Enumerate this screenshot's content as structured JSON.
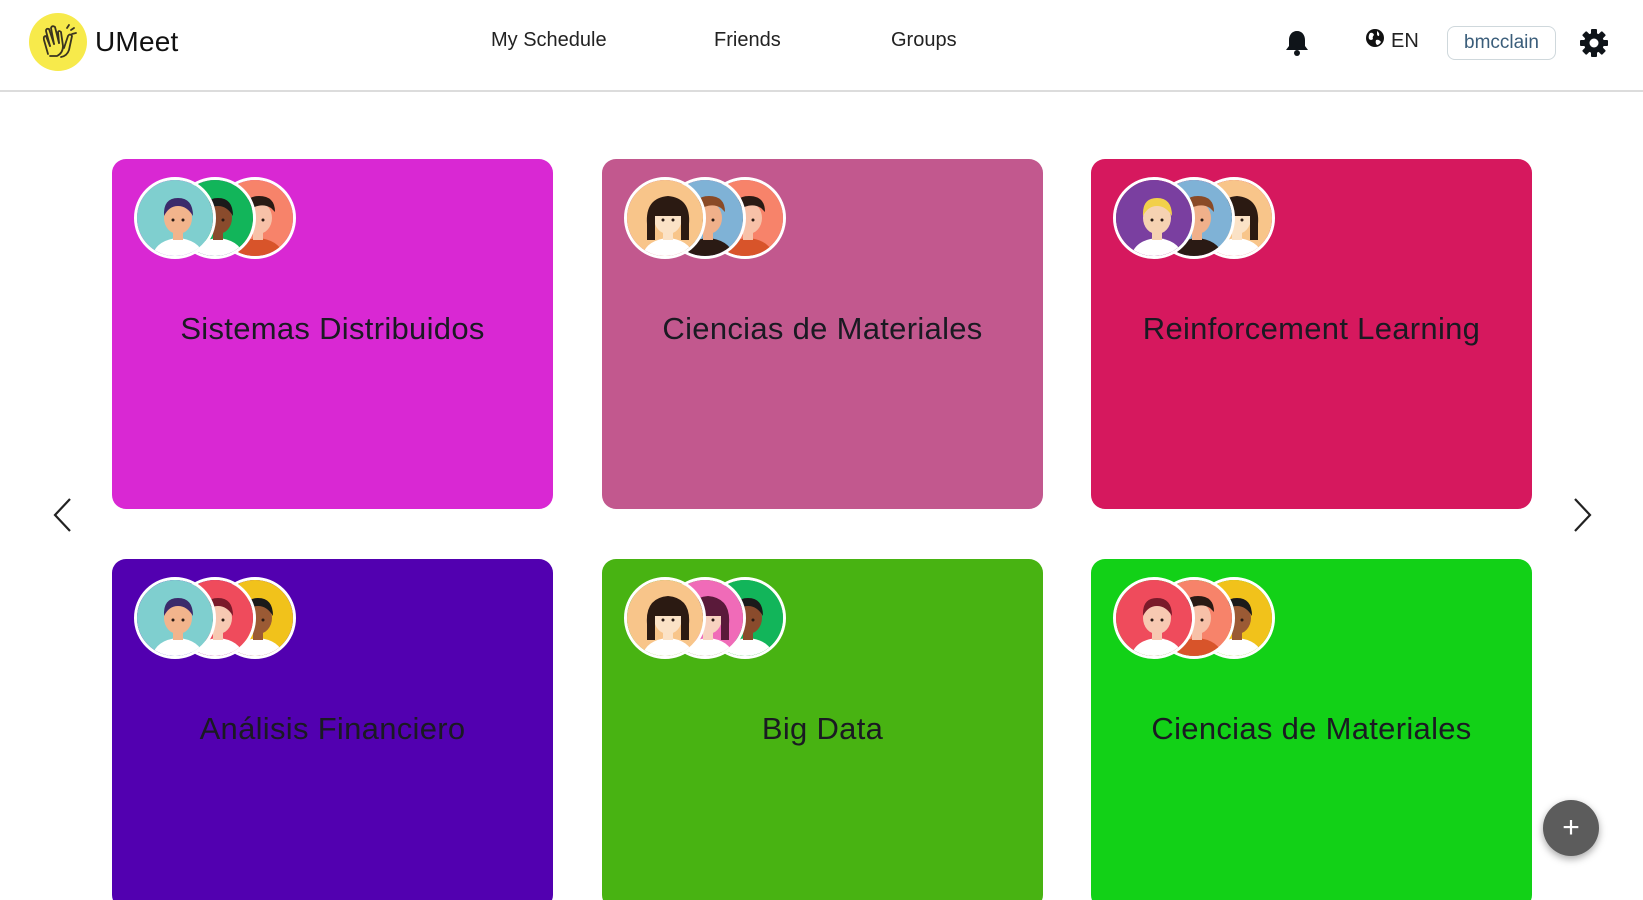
{
  "app": {
    "name": "UMeet"
  },
  "nav": {
    "items": [
      "My Schedule",
      "Friends",
      "Groups"
    ]
  },
  "header": {
    "language": "EN",
    "username": "bmcclain"
  },
  "groups": [
    {
      "title": "Sistemas Distribuidos",
      "color": "#d928d3",
      "avatars": [
        "teal-girl",
        "green-boy",
        "orange-man"
      ]
    },
    {
      "title": "Ciencias de Materiales",
      "color": "#c2588e",
      "avatars": [
        "bangs-girl",
        "brown-man",
        "orange-man"
      ]
    },
    {
      "title": "Reinforcement Learning",
      "color": "#d6185e",
      "avatars": [
        "purple-blonde",
        "brown-man",
        "bangs-girl"
      ]
    },
    {
      "title": "Análisis Financiero",
      "color": "#5200b0",
      "avatars": [
        "teal-girl",
        "red-girl",
        "yellow-boy"
      ]
    },
    {
      "title": "Big Data",
      "color": "#48b312",
      "avatars": [
        "bangs-girl",
        "pink-girl",
        "green-boy"
      ]
    },
    {
      "title": "Ciencias de Materiales",
      "color": "#12d117",
      "avatars": [
        "red-girl",
        "orange-man",
        "yellow-boy"
      ]
    }
  ],
  "fab": {
    "label": "+"
  }
}
